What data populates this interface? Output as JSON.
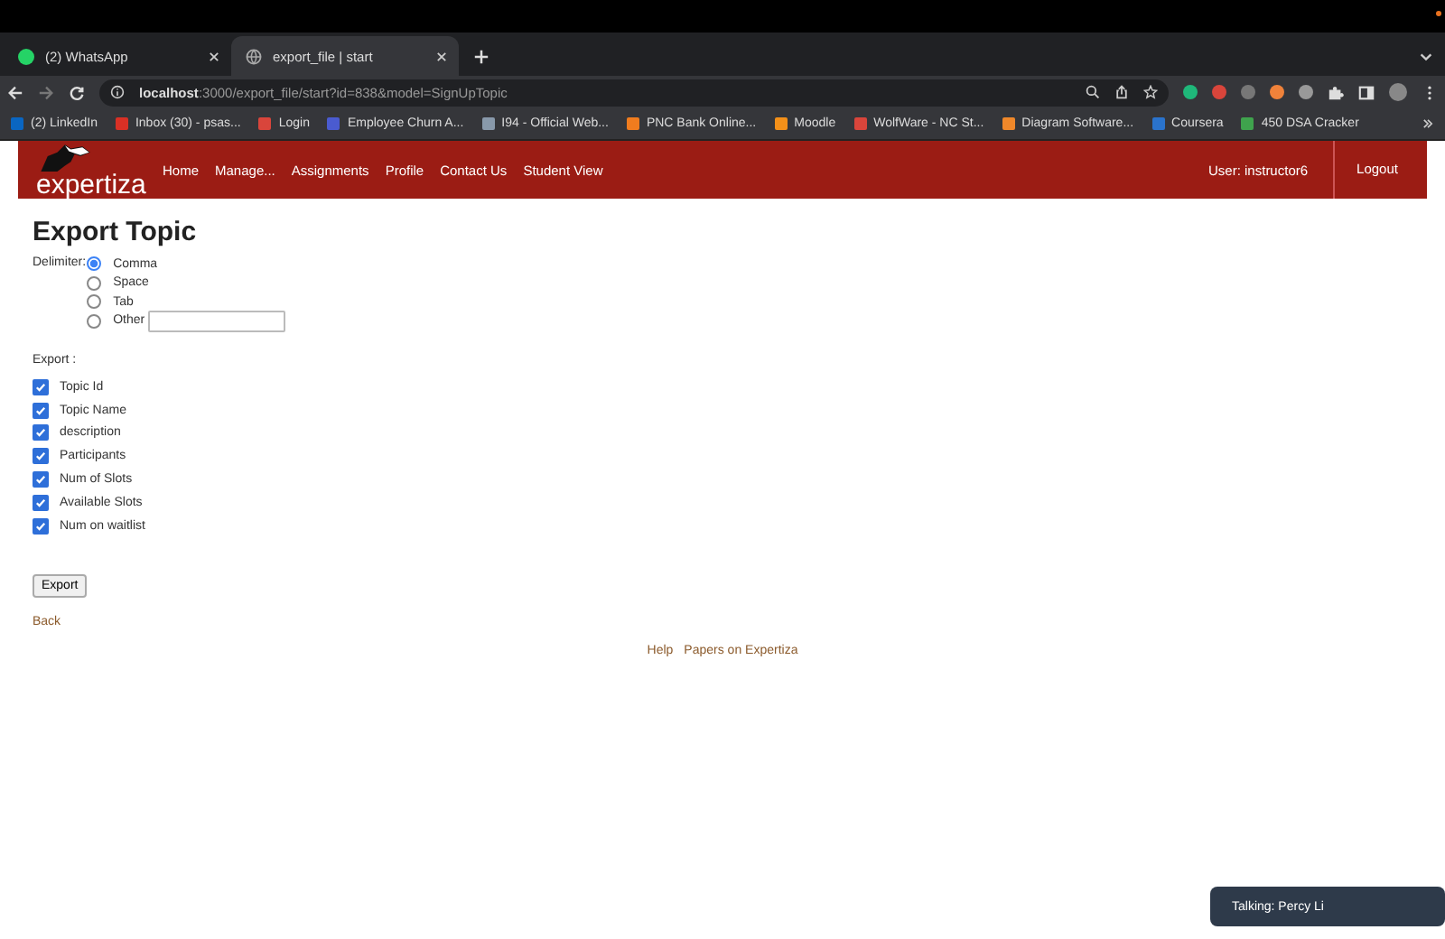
{
  "browser": {
    "tabs": [
      {
        "title": "(2) WhatsApp",
        "selected": false,
        "kind": "chat"
      },
      {
        "title": "export_file | start",
        "selected": true,
        "kind": "web"
      }
    ],
    "address": {
      "host": "localhost",
      "path": ":3000/export_file/start?id=838&model=SignUpTopic"
    },
    "extensions": [
      {
        "color": "#1fb87a"
      },
      {
        "color": "#d9453b"
      },
      {
        "color": "#777777"
      },
      {
        "color": "#f0823a"
      },
      {
        "color": "#999999"
      }
    ],
    "bookmarks": [
      {
        "label": "(2) LinkedIn",
        "color": "#0a66c2"
      },
      {
        "label": "Inbox (30) - psas...",
        "color": "#d93025"
      },
      {
        "label": "Login",
        "color": "#d9453b"
      },
      {
        "label": "Employee Churn A...",
        "color": "#4a5bd0"
      },
      {
        "label": "I94 - Official Web...",
        "color": "#8899aa"
      },
      {
        "label": "PNC Bank Online...",
        "color": "#f07c1e"
      },
      {
        "label": "Moodle",
        "color": "#f39019"
      },
      {
        "label": "WolfWare - NC St...",
        "color": "#d9453b"
      },
      {
        "label": "Diagram Software...",
        "color": "#f0882a"
      },
      {
        "label": "Coursera",
        "color": "#2a73cc"
      },
      {
        "label": "450 DSA Cracker",
        "color": "#3fa34d"
      }
    ]
  },
  "header": {
    "logo": "expertiza",
    "nav": [
      "Home",
      "Manage...",
      "Assignments",
      "Profile",
      "Contact Us",
      "Student View"
    ],
    "user": "User: instructor6",
    "logout": "Logout"
  },
  "title": "Export Topic",
  "delimiter": {
    "label": "Delimiter:",
    "options": [
      {
        "label": "Comma",
        "selected": true
      },
      {
        "label": "Space",
        "selected": false
      },
      {
        "label": "Tab",
        "selected": false
      },
      {
        "label": "Other",
        "selected": false
      }
    ]
  },
  "export": {
    "label": "Export :",
    "fields": [
      {
        "label": "Topic Id",
        "checked": true
      },
      {
        "label": "Topic Name",
        "checked": true
      },
      {
        "label": "description",
        "checked": true
      },
      {
        "label": "Participants",
        "checked": true
      },
      {
        "label": "Num of Slots",
        "checked": true
      },
      {
        "label": "Available Slots",
        "checked": true
      },
      {
        "label": "Num on waitlist",
        "checked": true
      }
    ]
  },
  "button": "Export",
  "back": "Back",
  "footer": [
    "Help",
    "Papers on Expertiza"
  ],
  "toast": "Talking: Percy Li"
}
